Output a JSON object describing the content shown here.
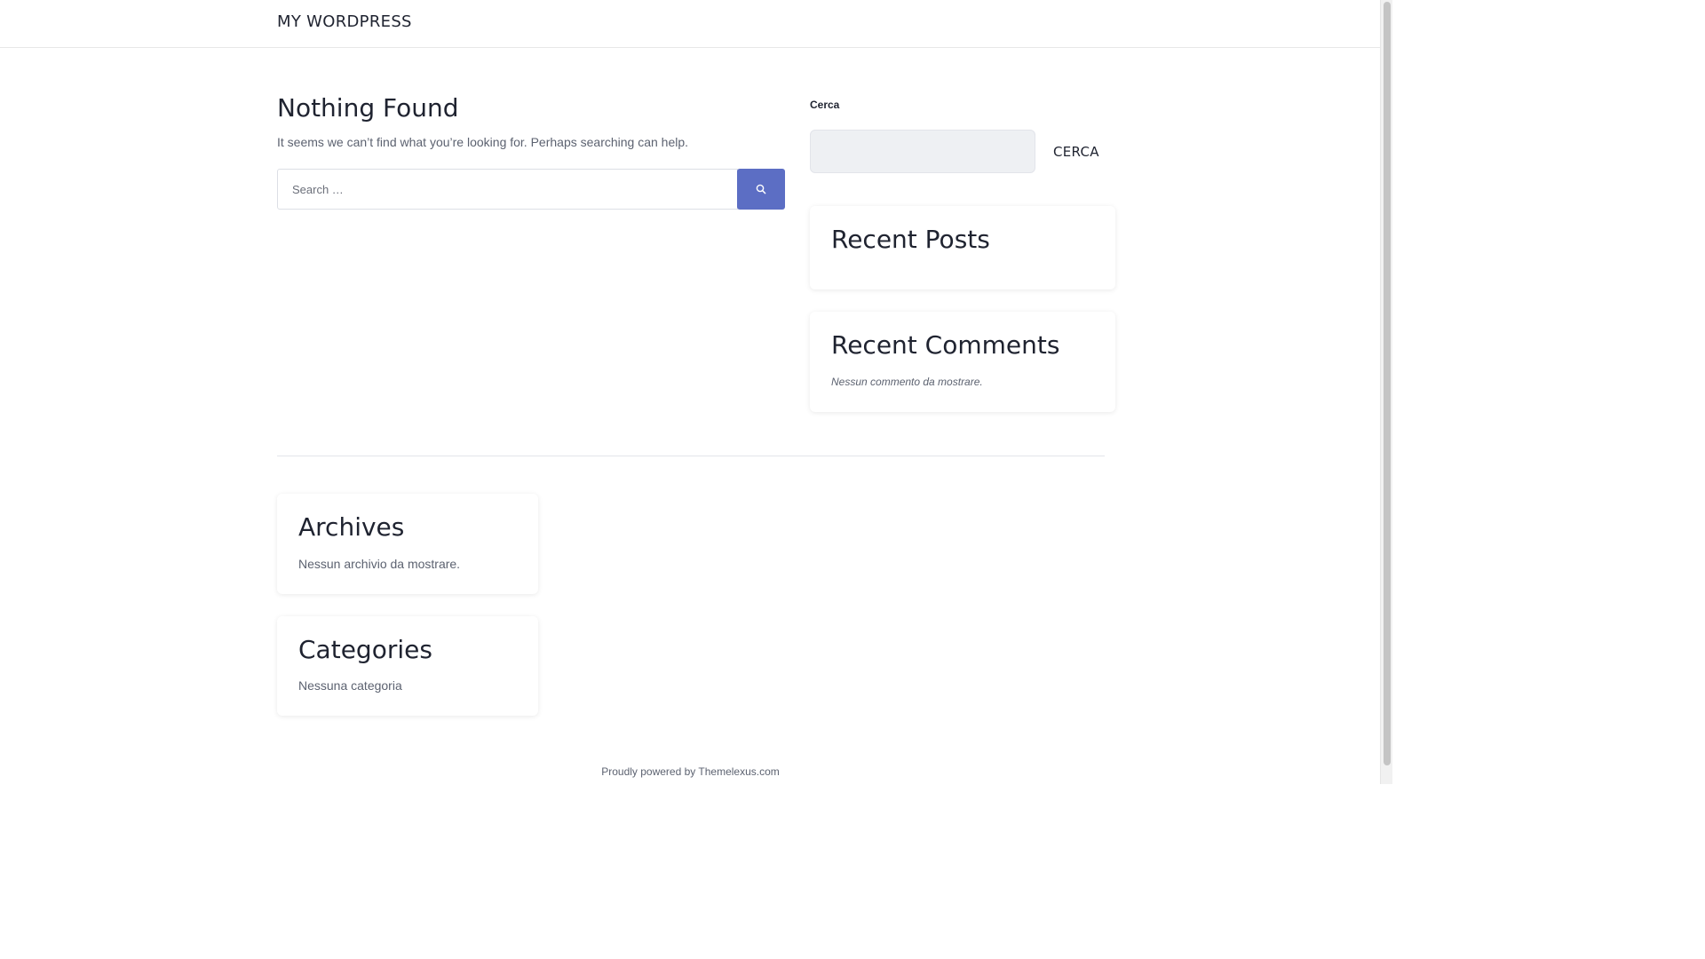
{
  "header": {
    "site_title": "MY WORDPRESS"
  },
  "main": {
    "title": "Nothing Found",
    "description": "It seems we can’t find what you’re looking for. Perhaps searching can help.",
    "search": {
      "placeholder": "Search …",
      "value": "",
      "submit_icon": "search-icon"
    }
  },
  "sidebar": {
    "search_label": "Cerca",
    "search_value": "",
    "search_button": "CERCA",
    "recent_posts": {
      "title": "Recent Posts"
    },
    "recent_comments": {
      "title": "Recent Comments",
      "empty_text": "Nessun commento da mostrare."
    }
  },
  "footer_widgets": {
    "archives": {
      "title": "Archives",
      "empty_text": "Nessun archivio da mostrare."
    },
    "categories": {
      "title": "Categories",
      "empty_text": "Nessuna categoria"
    }
  },
  "footer": {
    "prefix": "Proudly powered by ",
    "link_text": "Themelexus.com"
  },
  "colors": {
    "accent": "#5c6ec4",
    "text_dark": "#1f2330",
    "text_muted": "#5c6270",
    "input_bg": "#eef0f3"
  }
}
